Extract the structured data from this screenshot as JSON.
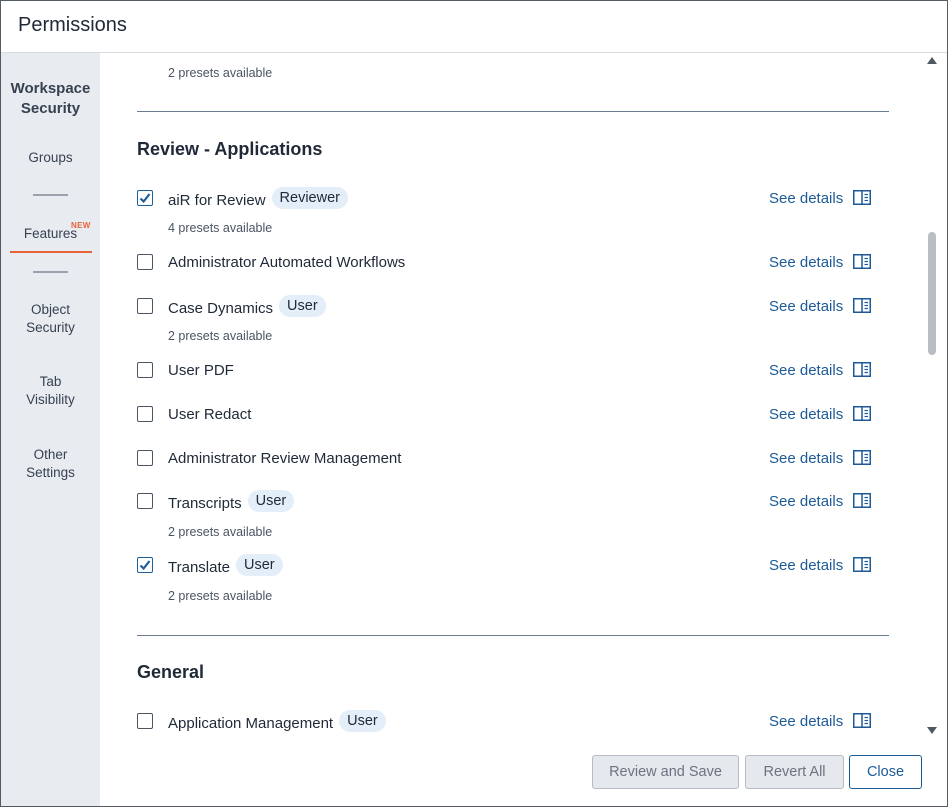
{
  "window": {
    "title": "Permissions"
  },
  "sidebar": {
    "heading": "Workspace Security",
    "items": [
      {
        "label": "Groups"
      },
      {
        "label": "Features",
        "badge": "NEW",
        "active": true
      },
      {
        "label": "Object Security"
      },
      {
        "label": "Tab Visibility"
      },
      {
        "label": "Other Settings"
      }
    ]
  },
  "content": {
    "prev_presets": "2 presets available",
    "sections": [
      {
        "title": "Review - Applications",
        "rows": [
          {
            "label": "aiR for Review",
            "checked": true,
            "pill": "Reviewer",
            "presets": "4 presets available",
            "details": "See details"
          },
          {
            "label": "Administrator Automated Workflows",
            "checked": false,
            "pill": "",
            "presets": "",
            "details": "See details"
          },
          {
            "label": "Case Dynamics",
            "checked": false,
            "pill": "User",
            "presets": "2 presets available",
            "details": "See details"
          },
          {
            "label": "User PDF",
            "checked": false,
            "pill": "",
            "presets": "",
            "details": "See details"
          },
          {
            "label": "User Redact",
            "checked": false,
            "pill": "",
            "presets": "",
            "details": "See details"
          },
          {
            "label": "Administrator Review Management",
            "checked": false,
            "pill": "",
            "presets": "",
            "details": "See details"
          },
          {
            "label": "Transcripts",
            "checked": false,
            "pill": "User",
            "presets": "2 presets available",
            "details": "See details"
          },
          {
            "label": "Translate",
            "checked": true,
            "pill": "User",
            "presets": "2 presets available",
            "details": "See details"
          }
        ]
      },
      {
        "title": "General",
        "rows": [
          {
            "label": "Application Management",
            "checked": false,
            "pill": "User",
            "presets": "",
            "details": "See details"
          }
        ]
      }
    ]
  },
  "footer": {
    "review_save": "Review and Save",
    "revert_all": "Revert All",
    "close": "Close"
  },
  "colors": {
    "accent": "#1d5a96",
    "active_tab": "#e8633a",
    "pill_bg": "#e3eef9",
    "sidebar_bg": "#e8ecf1"
  }
}
